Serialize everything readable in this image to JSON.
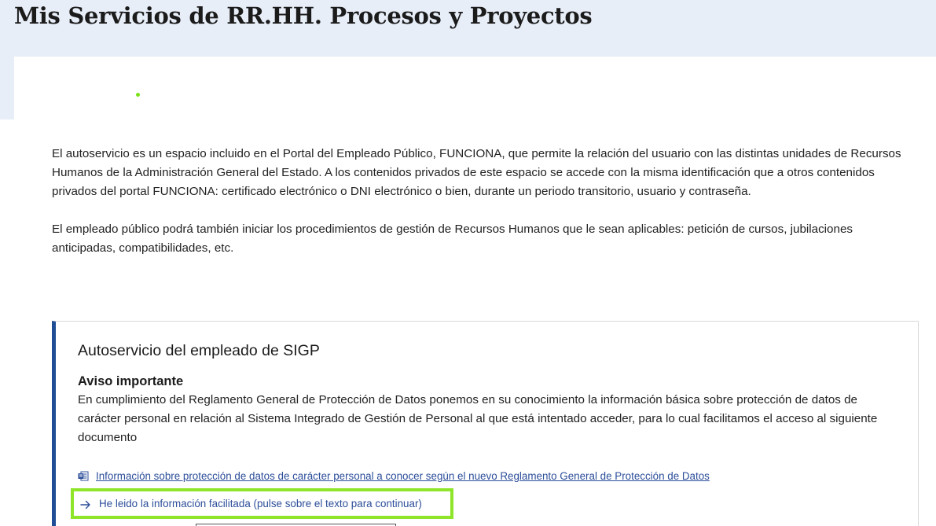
{
  "page": {
    "title": "Mis Servicios de RR.HH. Procesos y Proyectos"
  },
  "intro": {
    "paragraph_1": "El autoservicio es un espacio incluido en el Portal del Empleado Público, FUNCIONA, que permite la relación del usuario con las distintas unidades de Recursos Humanos de la Administración General del Estado. A los contenidos privados de este espacio se accede con la misma identificación que a otros contenidos privados del portal FUNCIONA: certificado electrónico o DNI electrónico o bien, durante un periodo transitorio, usuario y contraseña.",
    "paragraph_2": "El empleado público podrá también iniciar los procedimientos de gestión de Recursos Humanos que le sean aplicables: petición de cursos, jubilaciones anticipadas, compatibilidades, etc."
  },
  "sigp_panel": {
    "title": "Autoservicio del empleado de SIGP",
    "notice_title": "Aviso importante",
    "notice_text": "En cumplimiento del Reglamento General de Protección de Datos ponemos en su conocimiento la información básica sobre protección de datos de carácter personal en relación al Sistema Integrado de Gestión de Personal al que está intentado acceder, para lo cual facilitamos el acceso al siguiente documento",
    "document_link": {
      "icon": "document-icon",
      "label": "Información sobre protección de datos de carácter personal a conocer según el nuevo Reglamento General de Protección de Datos"
    },
    "continue_link": {
      "icon": "arrow-right-icon",
      "label": "He leido la información facilitada (pulse sobre el texto para continuar)"
    }
  },
  "colors": {
    "header_band": "#e8eef8",
    "panel_accent": "#1f4e96",
    "link": "#2c4e9a",
    "highlight": "#8ee52a",
    "green_dot": "#7ae11a"
  }
}
